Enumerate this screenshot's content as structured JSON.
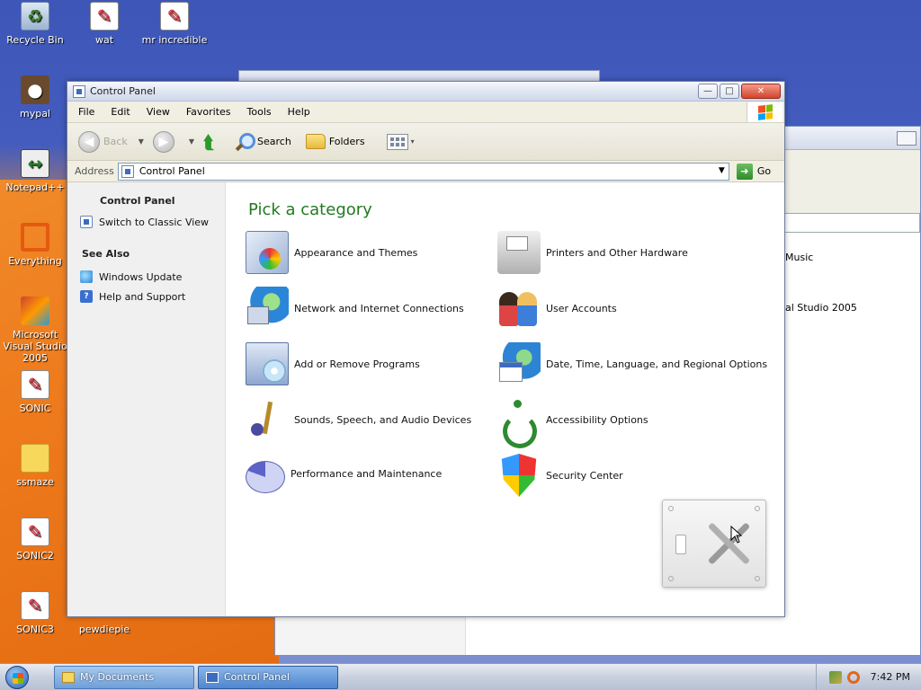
{
  "desktop": {
    "icons": [
      {
        "label": "Recycle Bin",
        "icon": "recycle-bin-icon"
      },
      {
        "label": "wat",
        "icon": "document-icon"
      },
      {
        "label": "mr incredible",
        "icon": "document-icon"
      },
      {
        "label": "mypal",
        "icon": "raccoon-icon"
      },
      {
        "label": "Notepad++",
        "icon": "notepad-icon"
      },
      {
        "label": "Everything",
        "icon": "search-ring-icon"
      },
      {
        "label": "Microsoft Visual Studio 2005",
        "icon": "visual-studio-icon"
      },
      {
        "label": "SONIC",
        "icon": "document-icon"
      },
      {
        "label": "ssmaze",
        "icon": "folder-icon"
      },
      {
        "label": "SONIC2",
        "icon": "document-icon"
      },
      {
        "label": "SONIC3",
        "icon": "document-icon"
      },
      {
        "label": "pewdiepie",
        "icon": "document-icon"
      }
    ]
  },
  "background_window": {
    "items": [
      "Music",
      "al Studio 2005"
    ]
  },
  "window": {
    "title": "Control Panel",
    "buttons": {
      "minimize": "—",
      "maximize": "□",
      "close": "✕"
    },
    "menu": [
      "File",
      "Edit",
      "View",
      "Favorites",
      "Tools",
      "Help"
    ],
    "toolbar": {
      "back": "Back",
      "search": "Search",
      "folders": "Folders"
    },
    "address": {
      "label": "Address",
      "value": "Control Panel",
      "go": "Go"
    },
    "left_pane": {
      "title": "Control Panel",
      "switch_view": "Switch to Classic View",
      "see_also_title": "See Also",
      "see_also": [
        "Windows Update",
        "Help and Support"
      ]
    },
    "main": {
      "heading": "Pick a category",
      "categories": [
        {
          "label": "Appearance and Themes",
          "icon": "appearance-themes-icon"
        },
        {
          "label": "Printers and Other Hardware",
          "icon": "printer-icon"
        },
        {
          "label": "Network and Internet Connections",
          "icon": "network-globe-icon"
        },
        {
          "label": "User Accounts",
          "icon": "user-accounts-icon"
        },
        {
          "label": "Add or Remove Programs",
          "icon": "add-remove-programs-icon"
        },
        {
          "label": "Date, Time, Language, and Regional Options",
          "icon": "date-time-globe-icon"
        },
        {
          "label": "Sounds, Speech, and Audio Devices",
          "icon": "music-note-icon"
        },
        {
          "label": "Accessibility Options",
          "icon": "accessibility-icon"
        },
        {
          "label": "Performance and Maintenance",
          "icon": "pie-chart-icon"
        },
        {
          "label": "Security Center",
          "icon": "security-shield-icon"
        }
      ]
    }
  },
  "taskbar": {
    "tasks": [
      "My Documents",
      "Control Panel"
    ],
    "clock": "7:42 PM"
  },
  "colors": {
    "heading_green": "#217a21",
    "link_blue": "#3a6cc0"
  }
}
